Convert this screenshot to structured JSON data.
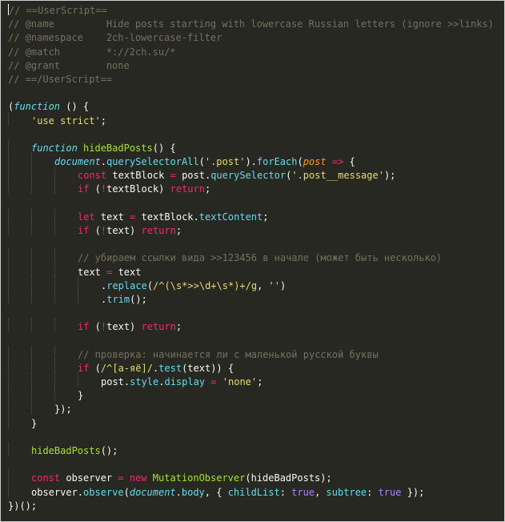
{
  "editor": {
    "theme": "monokai",
    "background": "#272822",
    "colors": {
      "comment": "#75715e",
      "keyword": "#f92672",
      "function": "#a6e22e",
      "string": "#e6db74",
      "builtin": "#66d9ef",
      "param": "#fd971f",
      "constant": "#ae81ff",
      "text": "#f8f8f2"
    }
  },
  "lines": [
    [
      [
        "c",
        "// ==UserScript=="
      ]
    ],
    [
      [
        "c",
        "// @name         Hide posts starting with lowercase Russian letters (ignore >>links)"
      ]
    ],
    [
      [
        "c",
        "// @namespace    2ch-lowercase-filter"
      ]
    ],
    [
      [
        "c",
        "// @match        *://2ch.su/*"
      ]
    ],
    [
      [
        "c",
        "// @grant        none"
      ]
    ],
    [
      [
        "c",
        "// ==/UserScript=="
      ]
    ],
    [],
    [
      [
        "t",
        "("
      ],
      [
        "kw",
        "function"
      ],
      [
        "t",
        " () {"
      ]
    ],
    [
      [
        "i",
        1
      ],
      [
        "s",
        "'use strict'"
      ],
      [
        "t",
        ";"
      ]
    ],
    [],
    [
      [
        "i",
        1
      ],
      [
        "kw",
        "function"
      ],
      [
        "t",
        " "
      ],
      [
        "f",
        "hideBadPosts"
      ],
      [
        "t",
        "() {"
      ]
    ],
    [
      [
        "i",
        2
      ],
      [
        "b",
        "document"
      ],
      [
        "t",
        "."
      ],
      [
        "m",
        "querySelectorAll"
      ],
      [
        "t",
        "("
      ],
      [
        "s",
        "'.post'"
      ],
      [
        "t",
        ")."
      ],
      [
        "m",
        "forEach"
      ],
      [
        "t",
        "("
      ],
      [
        "p",
        "post"
      ],
      [
        "t",
        " "
      ],
      [
        "k",
        "=>"
      ],
      [
        "t",
        " {"
      ]
    ],
    [
      [
        "i",
        3
      ],
      [
        "k",
        "const"
      ],
      [
        "t",
        " textBlock "
      ],
      [
        "k",
        "="
      ],
      [
        "t",
        " post."
      ],
      [
        "m",
        "querySelector"
      ],
      [
        "t",
        "("
      ],
      [
        "s",
        "'.post__message'"
      ],
      [
        "t",
        ");"
      ]
    ],
    [
      [
        "i",
        3
      ],
      [
        "k",
        "if"
      ],
      [
        "t",
        " ("
      ],
      [
        "k",
        "!"
      ],
      [
        "t",
        "textBlock) "
      ],
      [
        "k",
        "return"
      ],
      [
        "t",
        ";"
      ]
    ],
    [],
    [
      [
        "i",
        3
      ],
      [
        "k",
        "let"
      ],
      [
        "t",
        " text "
      ],
      [
        "k",
        "="
      ],
      [
        "t",
        " textBlock."
      ],
      [
        "m",
        "textContent"
      ],
      [
        "t",
        ";"
      ]
    ],
    [
      [
        "i",
        3
      ],
      [
        "k",
        "if"
      ],
      [
        "t",
        " ("
      ],
      [
        "k",
        "!"
      ],
      [
        "t",
        "text) "
      ],
      [
        "k",
        "return"
      ],
      [
        "t",
        ";"
      ]
    ],
    [],
    [
      [
        "i",
        3
      ],
      [
        "c",
        "// убираем ссылки вида >>123456 в начале (может быть несколько)"
      ]
    ],
    [
      [
        "i",
        3
      ],
      [
        "t",
        "text "
      ],
      [
        "k",
        "="
      ],
      [
        "t",
        " text"
      ]
    ],
    [
      [
        "i",
        4
      ],
      [
        "t",
        "."
      ],
      [
        "m",
        "replace"
      ],
      [
        "t",
        "("
      ],
      [
        "s",
        "/^(\\s*>>\\d+\\s*)+/g"
      ],
      [
        "t",
        ", "
      ],
      [
        "s",
        "''"
      ],
      [
        "t",
        ")"
      ]
    ],
    [
      [
        "i",
        4
      ],
      [
        "t",
        "."
      ],
      [
        "m",
        "trim"
      ],
      [
        "t",
        "();"
      ]
    ],
    [],
    [
      [
        "i",
        3
      ],
      [
        "k",
        "if"
      ],
      [
        "t",
        " ("
      ],
      [
        "k",
        "!"
      ],
      [
        "t",
        "text) "
      ],
      [
        "k",
        "return"
      ],
      [
        "t",
        ";"
      ]
    ],
    [],
    [
      [
        "i",
        3
      ],
      [
        "c",
        "// проверка: начинается ли с маленькой русской буквы"
      ]
    ],
    [
      [
        "i",
        3
      ],
      [
        "k",
        "if"
      ],
      [
        "t",
        " ("
      ],
      [
        "s",
        "/^[а-яё]/"
      ],
      [
        "t",
        "."
      ],
      [
        "m",
        "test"
      ],
      [
        "t",
        "(text)) {"
      ]
    ],
    [
      [
        "i",
        4
      ],
      [
        "t",
        "post."
      ],
      [
        "m",
        "style"
      ],
      [
        "t",
        "."
      ],
      [
        "m",
        "display"
      ],
      [
        "t",
        " "
      ],
      [
        "k",
        "="
      ],
      [
        "t",
        " "
      ],
      [
        "s",
        "'none'"
      ],
      [
        "t",
        ";"
      ]
    ],
    [
      [
        "i",
        3
      ],
      [
        "t",
        "}"
      ]
    ],
    [
      [
        "i",
        2
      ],
      [
        "t",
        "});"
      ]
    ],
    [
      [
        "i",
        1
      ],
      [
        "t",
        "}"
      ]
    ],
    [],
    [
      [
        "i",
        1
      ],
      [
        "f",
        "hideBadPosts"
      ],
      [
        "t",
        "();"
      ]
    ],
    [],
    [
      [
        "i",
        1
      ],
      [
        "k",
        "const"
      ],
      [
        "t",
        " observer "
      ],
      [
        "k",
        "="
      ],
      [
        "t",
        " "
      ],
      [
        "k",
        "new"
      ],
      [
        "t",
        " "
      ],
      [
        "f",
        "MutationObserver"
      ],
      [
        "t",
        "(hideBadPosts);"
      ]
    ],
    [
      [
        "i",
        1
      ],
      [
        "t",
        "observer."
      ],
      [
        "m",
        "observe"
      ],
      [
        "t",
        "("
      ],
      [
        "b",
        "document"
      ],
      [
        "t",
        "."
      ],
      [
        "m",
        "body"
      ],
      [
        "t",
        ", { "
      ],
      [
        "m",
        "childList"
      ],
      [
        "t",
        ": "
      ],
      [
        "n",
        "true"
      ],
      [
        "t",
        ", "
      ],
      [
        "m",
        "subtree"
      ],
      [
        "t",
        ": "
      ],
      [
        "n",
        "true"
      ],
      [
        "t",
        " });"
      ]
    ],
    [
      [
        "t",
        "})();"
      ]
    ]
  ]
}
